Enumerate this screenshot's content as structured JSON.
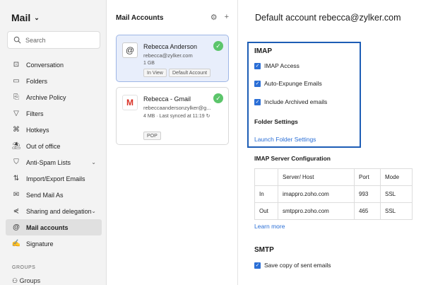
{
  "sidebar": {
    "title": "Mail",
    "search_placeholder": "Search",
    "items": [
      {
        "label": "Conversation",
        "icon": "conversation-icon",
        "glyph": "⊡"
      },
      {
        "label": "Folders",
        "icon": "folder-icon",
        "glyph": "▭"
      },
      {
        "label": "Archive Policy",
        "icon": "archive-icon",
        "glyph": "⎘"
      },
      {
        "label": "Filters",
        "icon": "filter-icon",
        "glyph": "▽"
      },
      {
        "label": "Hotkeys",
        "icon": "hotkey-icon",
        "glyph": "⌘"
      },
      {
        "label": "Out of office",
        "icon": "out-of-office-icon",
        "glyph": "⛱"
      },
      {
        "label": "Anti-Spam Lists",
        "icon": "shield-icon",
        "glyph": "⛉",
        "expandable": true
      },
      {
        "label": "Import/Export Emails",
        "icon": "import-export-icon",
        "glyph": "⇅"
      },
      {
        "label": "Send Mail As",
        "icon": "send-as-icon",
        "glyph": "✉"
      },
      {
        "label": "Sharing and delegation",
        "icon": "share-icon",
        "glyph": "⋞",
        "expandable": true
      },
      {
        "label": "Mail accounts",
        "icon": "at-icon",
        "glyph": "@",
        "active": true
      },
      {
        "label": "Signature",
        "icon": "signature-icon",
        "glyph": "✍"
      }
    ],
    "groups_label": "GROUPS",
    "groups_item": "Groups"
  },
  "accounts": {
    "header": "Mail Accounts",
    "cards": [
      {
        "name": "Rebecca Anderson",
        "email": "rebecca@zylker.com",
        "meta": "1 GB",
        "tags": [
          "In View",
          "Default Account"
        ],
        "logo": "@",
        "selected": true
      },
      {
        "name": "Rebecca - Gmail",
        "email": "rebeccaandersonzylker@g...",
        "meta": "4 MB · Last synced at 11:19",
        "tags": [
          "POP"
        ],
        "logo": "M",
        "selected": false
      }
    ]
  },
  "content": {
    "title": "Default account rebecca@zylker.com",
    "imap": {
      "heading": "IMAP",
      "options": [
        "IMAP Access",
        "Auto-Expunge Emails",
        "Include Archived emails"
      ],
      "folder_settings_title": "Folder Settings",
      "folder_settings_link": "Launch Folder Settings"
    },
    "server_config": {
      "heading": "IMAP Server Configuration",
      "columns": [
        "",
        "Server/ Host",
        "Port",
        "Mode"
      ],
      "rows": [
        [
          "In",
          "imappro.zoho.com",
          "993",
          "SSL"
        ],
        [
          "Out",
          "smtppro.zoho.com",
          "465",
          "SSL"
        ]
      ],
      "learn_more": "Learn more"
    },
    "smtp": {
      "heading": "SMTP",
      "option": "Save copy of sent emails"
    }
  },
  "colors": {
    "accent": "#2b6fd6",
    "highlight_border": "#1d5db5",
    "success": "#5cc56b",
    "gmail_red": "#d93025"
  }
}
